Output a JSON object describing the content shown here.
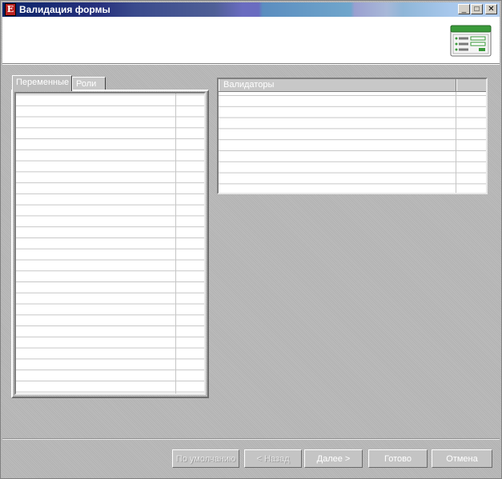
{
  "window": {
    "title": "Валидация формы",
    "app_icon_letter": "Е",
    "controls": {
      "minimize": "_",
      "maximize": "□",
      "close": "✕"
    }
  },
  "tabs": [
    {
      "label": "Переменные",
      "active": true
    },
    {
      "label": "Роли",
      "active": false
    }
  ],
  "variables_grid": {
    "rows": 28
  },
  "validators_grid": {
    "header": "Валидаторы",
    "rows": 9
  },
  "buttons": {
    "defaults": "По умолчанию",
    "back": "< Назад",
    "next": "Далее >",
    "finish": "Готово",
    "cancel": "Отмена"
  },
  "colors": {
    "title_start": "#0c246a",
    "title_end": "#b5cff0",
    "icon_green": "#3a9a3a"
  }
}
